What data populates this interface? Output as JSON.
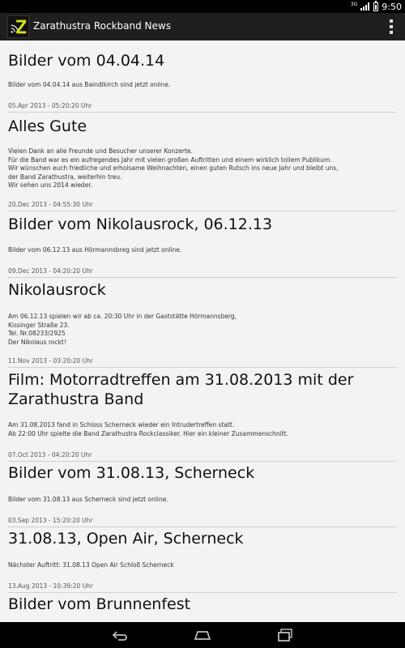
{
  "status_bar": {
    "time": "9:50",
    "network_label": "3G",
    "icons": [
      "network-3g-icon",
      "signal-icon",
      "battery-icon"
    ]
  },
  "action_bar": {
    "title": "Zarathustra Rockband News",
    "app_icon": "zarathustra-app-icon",
    "menu_icon": "overflow-menu-icon"
  },
  "colors": {
    "status_bar_bg": "#000000",
    "action_bar_bg": "#1f1f1f",
    "content_bg": "#f3f3f3",
    "divider": "#cfcfcf",
    "app_icon_accent": "#d6e020"
  },
  "news": [
    {
      "title": "Bilder vom 04.04.14",
      "body": [
        "Bilder vom 04.04.14 aus Baindlkirch sind jetzt online."
      ],
      "date": "05.Apr 2013 - 05:20:20 Uhr"
    },
    {
      "title": "Alles Gute",
      "body": [
        "Vielen Dank an alle Freunde und Besucher unserer Konzerte.",
        "Für die Band war es ein aufregendes Jahr mit vielen großen Auftritten und einem wirklich tollem Publikum.",
        "Wir wünschen euch friedliche und erholsame Weihnachten, einen guten Rutsch ins neue Jahr und bleibt uns,",
        "der Band Zarathustra, weiterhin treu.",
        "Wir sehen uns 2014 wieder."
      ],
      "date": "20.Dec 2013 - 04:55:30 Uhr"
    },
    {
      "title": "Bilder vom Nikolausrock, 06.12.13",
      "body": [
        "Bilder vom 06.12.13 aus Hörmannsbreg sind jetzt online."
      ],
      "date": "09.Dec 2013 - 04:20:20 Uhr"
    },
    {
      "title": "Nikolausrock",
      "body": [
        "Am 06.12.13 spielen wir ab ca. 20:30 Uhr in der Gaststätte Hörmannsberg,",
        "Kissinger Straße 23.",
        "Tel. Nr.08233/2925",
        "Der Nikolaus rockt!"
      ],
      "date": "11.Nov 2013 - 03:20:20 Uhr"
    },
    {
      "title": "Film: Motorradtreffen am 31.08.2013 mit der Zarathustra Band",
      "title_lines": [
        "Film: Motorradtreffen am 31.08.2013 mit der",
        "Zarathustra Band"
      ],
      "body": [
        "Am 31.08.2013 fand in Schloss Scherneck wieder ein Intrudertreffen statt.",
        "Ab 22:00 Uhr spielte die Band Zarathustra Rockclassiker. Hier ein kleiner Zusammenschnitt."
      ],
      "date": "07.Oct 2013 - 04:20:20 Uhr"
    },
    {
      "title": "Bilder vom 31.08.13, Scherneck",
      "body": [
        "Bilder vom 31.08.13 aus Scherneck sind jetzt online."
      ],
      "date": "03.Sep 2013 - 15:20:20 Uhr"
    },
    {
      "title": "31.08.13, Open Air, Scherneck",
      "body": [
        "Nächster Auftritt:  31.08.13 Open Air Schloß Scherneck"
      ],
      "date": "13.Aug 2013 - 10:39:20 Uhr"
    },
    {
      "title": "Bilder vom Brunnenfest",
      "body": [],
      "date": ""
    }
  ],
  "nav_bar": {
    "icons": [
      "back-icon",
      "home-icon",
      "recent-apps-icon"
    ]
  }
}
